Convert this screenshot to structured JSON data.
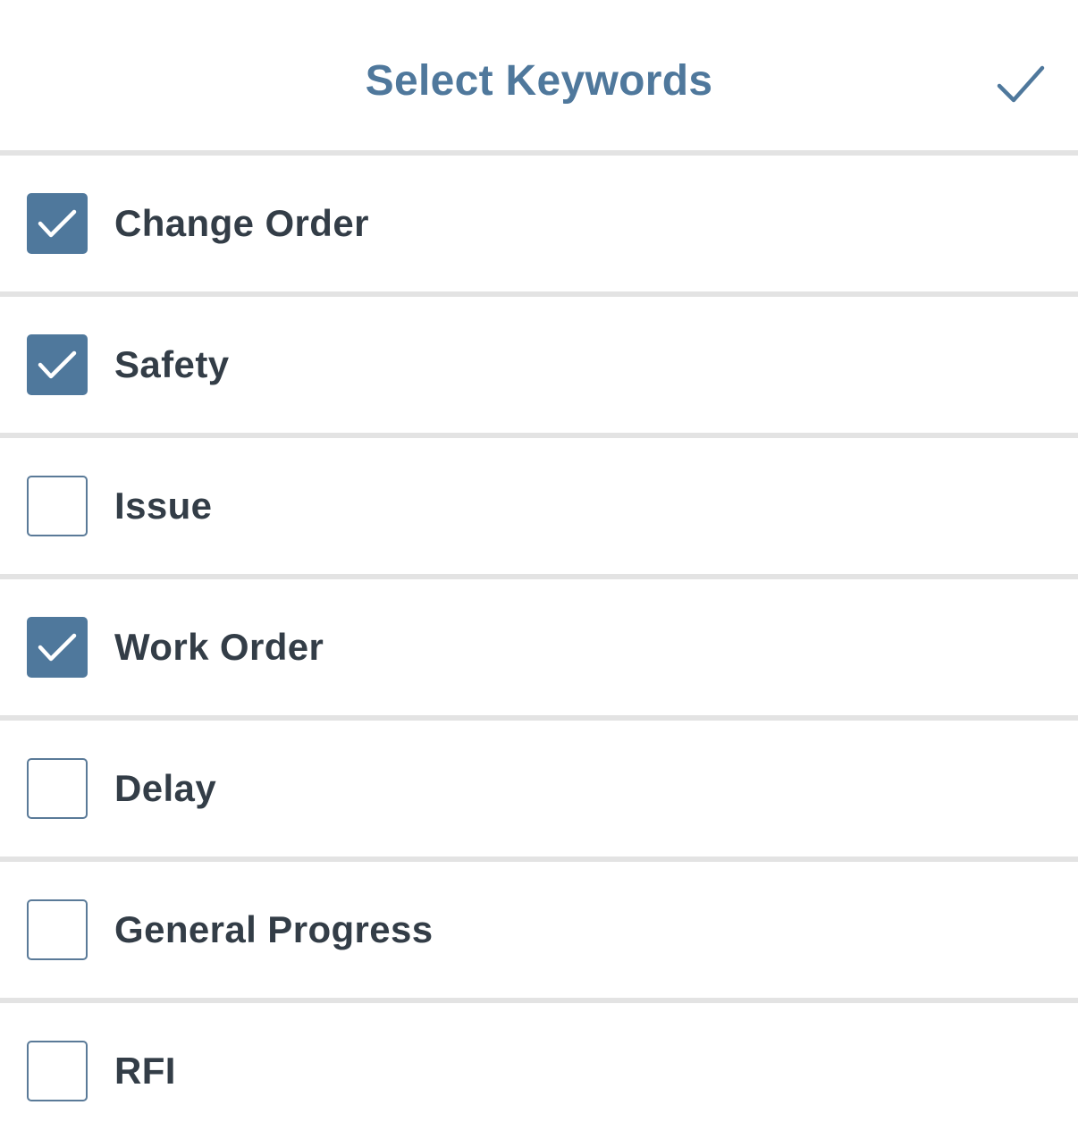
{
  "header": {
    "title": "Select Keywords",
    "done_icon": "checkmark-icon"
  },
  "colors": {
    "accent": "#4f789c",
    "text": "#333d47",
    "separator": "#e3e3e3",
    "checkbox_border": "#5a7a98"
  },
  "keywords": [
    {
      "label": "Change Order",
      "checked": true
    },
    {
      "label": "Safety",
      "checked": true
    },
    {
      "label": "Issue",
      "checked": false
    },
    {
      "label": "Work Order",
      "checked": true
    },
    {
      "label": "Delay",
      "checked": false
    },
    {
      "label": "General Progress",
      "checked": false
    },
    {
      "label": "RFI",
      "checked": false
    }
  ]
}
